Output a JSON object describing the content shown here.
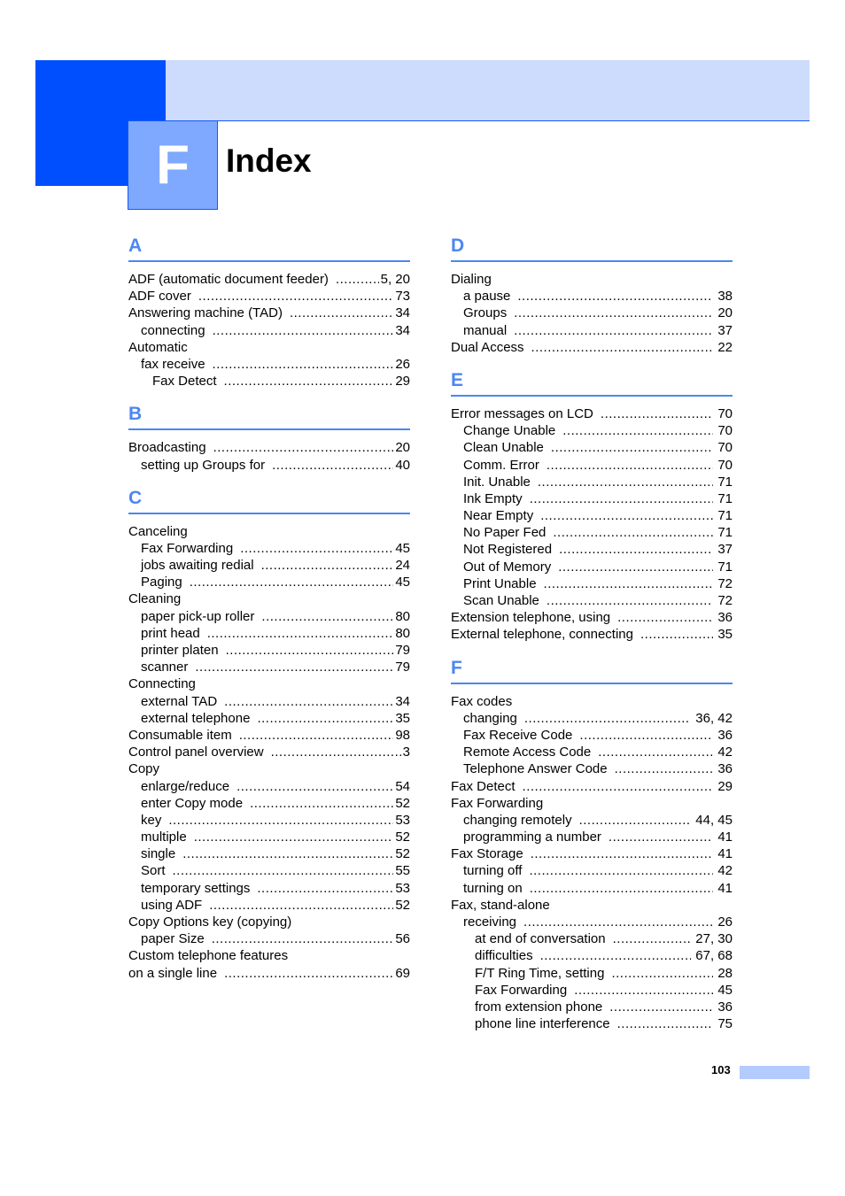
{
  "header": {
    "chapter_letter": "F",
    "title": "Index"
  },
  "colors": {
    "primary_blue": "#004ffe",
    "light_blue": "#cddcfd",
    "letter_box": "#7fa8ff",
    "section_blue": "#4c86f2",
    "page_bar": "#b3cbfd"
  },
  "left_column": [
    {
      "letter": "A",
      "entries": [
        {
          "label": "ADF (automatic document feeder)",
          "pages": "5, 20",
          "level": 0
        },
        {
          "label": "ADF cover",
          "pages": "73",
          "level": 0
        },
        {
          "label": "Answering machine (TAD)",
          "pages": "34",
          "level": 0
        },
        {
          "label": "connecting",
          "pages": "34",
          "level": 1
        },
        {
          "label": "Automatic",
          "pages": "",
          "level": 0
        },
        {
          "label": "fax receive",
          "pages": "26",
          "level": 1
        },
        {
          "label": "Fax Detect",
          "pages": "29",
          "level": 2
        }
      ]
    },
    {
      "letter": "B",
      "entries": [
        {
          "label": "Broadcasting",
          "pages": "20",
          "level": 0
        },
        {
          "label": "setting up Groups for",
          "pages": "40",
          "level": 1
        }
      ]
    },
    {
      "letter": "C",
      "entries": [
        {
          "label": "Canceling",
          "pages": "",
          "level": 0
        },
        {
          "label": "Fax Forwarding",
          "pages": "45",
          "level": 1
        },
        {
          "label": "jobs awaiting redial",
          "pages": "24",
          "level": 1
        },
        {
          "label": "Paging",
          "pages": "45",
          "level": 1
        },
        {
          "label": "Cleaning",
          "pages": "",
          "level": 0
        },
        {
          "label": "paper pick-up roller",
          "pages": "80",
          "level": 1
        },
        {
          "label": "print head",
          "pages": "80",
          "level": 1
        },
        {
          "label": "printer platen",
          "pages": "79",
          "level": 1
        },
        {
          "label": "scanner",
          "pages": "79",
          "level": 1
        },
        {
          "label": "Connecting",
          "pages": "",
          "level": 0
        },
        {
          "label": "external TAD",
          "pages": "34",
          "level": 1
        },
        {
          "label": "external telephone",
          "pages": "35",
          "level": 1
        },
        {
          "label": "Consumable item",
          "pages": "98",
          "level": 0
        },
        {
          "label": "Control panel overview",
          "pages": "3",
          "level": 0
        },
        {
          "label": "Copy",
          "pages": "",
          "level": 0
        },
        {
          "label": "enlarge/reduce",
          "pages": "54",
          "level": 1
        },
        {
          "label": "enter Copy mode",
          "pages": "52",
          "level": 1
        },
        {
          "label": "key",
          "pages": "53",
          "level": 1
        },
        {
          "label": "multiple",
          "pages": "52",
          "level": 1
        },
        {
          "label": "single",
          "pages": "52",
          "level": 1
        },
        {
          "label": "Sort",
          "pages": "55",
          "level": 1
        },
        {
          "label": "temporary settings",
          "pages": "53",
          "level": 1
        },
        {
          "label": "using ADF",
          "pages": "52",
          "level": 1
        },
        {
          "label": "Copy Options key (copying)",
          "pages": "",
          "level": 0
        },
        {
          "label": "paper Size",
          "pages": "56",
          "level": 1
        },
        {
          "label": "Custom telephone features",
          "pages": "",
          "level": 0
        },
        {
          "label": "on a single line",
          "pages": "69",
          "level": 0
        }
      ]
    }
  ],
  "right_column": [
    {
      "letter": "D",
      "entries": [
        {
          "label": "Dialing",
          "pages": "",
          "level": 0
        },
        {
          "label": "a pause",
          "pages": "38",
          "level": 1
        },
        {
          "label": "Groups",
          "pages": "20",
          "level": 1
        },
        {
          "label": "manual",
          "pages": "37",
          "level": 1
        },
        {
          "label": "Dual Access",
          "pages": "22",
          "level": 0
        }
      ]
    },
    {
      "letter": "E",
      "entries": [
        {
          "label": "Error messages on LCD",
          "pages": "70",
          "level": 0
        },
        {
          "label": "Change Unable",
          "pages": "70",
          "level": 1
        },
        {
          "label": "Clean Unable",
          "pages": "70",
          "level": 1
        },
        {
          "label": "Comm. Error",
          "pages": "70",
          "level": 1
        },
        {
          "label": "Init. Unable",
          "pages": "71",
          "level": 1
        },
        {
          "label": "Ink Empty",
          "pages": "71",
          "level": 1
        },
        {
          "label": "Near Empty",
          "pages": "71",
          "level": 1
        },
        {
          "label": "No Paper Fed",
          "pages": "71",
          "level": 1
        },
        {
          "label": "Not Registered",
          "pages": "37",
          "level": 1
        },
        {
          "label": "Out of Memory",
          "pages": "71",
          "level": 1
        },
        {
          "label": "Print Unable",
          "pages": "72",
          "level": 1
        },
        {
          "label": "Scan Unable",
          "pages": "72",
          "level": 1
        },
        {
          "label": "Extension telephone, using",
          "pages": "36",
          "level": 0
        },
        {
          "label": "External telephone, connecting",
          "pages": "35",
          "level": 0
        }
      ]
    },
    {
      "letter": "F",
      "entries": [
        {
          "label": "Fax codes",
          "pages": "",
          "level": 0
        },
        {
          "label": "changing",
          "pages": "36, 42",
          "level": 1
        },
        {
          "label": "Fax Receive Code",
          "pages": "36",
          "level": 1
        },
        {
          "label": "Remote Access Code",
          "pages": "42",
          "level": 1
        },
        {
          "label": "Telephone Answer Code",
          "pages": "36",
          "level": 1
        },
        {
          "label": "Fax Detect",
          "pages": "29",
          "level": 0
        },
        {
          "label": "Fax Forwarding",
          "pages": "",
          "level": 0
        },
        {
          "label": "changing remotely",
          "pages": "44, 45",
          "level": 1
        },
        {
          "label": "programming a number",
          "pages": "41",
          "level": 1
        },
        {
          "label": "Fax Storage",
          "pages": "41",
          "level": 0
        },
        {
          "label": "turning off",
          "pages": "42",
          "level": 1
        },
        {
          "label": "turning on",
          "pages": "41",
          "level": 1
        },
        {
          "label": "Fax, stand-alone",
          "pages": "",
          "level": 0
        },
        {
          "label": "receiving",
          "pages": "26",
          "level": 1
        },
        {
          "label": "at end of conversation",
          "pages": "27, 30",
          "level": 2
        },
        {
          "label": "difficulties",
          "pages": "67, 68",
          "level": 2
        },
        {
          "label": "F/T Ring Time, setting",
          "pages": "28",
          "level": 2
        },
        {
          "label": "Fax Forwarding",
          "pages": "45",
          "level": 2
        },
        {
          "label": "from extension phone",
          "pages": "36",
          "level": 2
        },
        {
          "label": "phone line interference",
          "pages": "75",
          "level": 2
        }
      ]
    }
  ],
  "footer": {
    "page_number": "103"
  }
}
